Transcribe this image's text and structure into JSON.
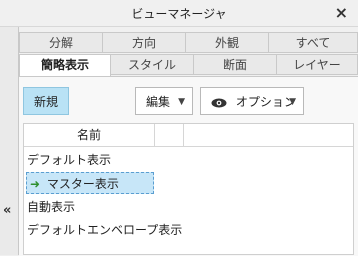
{
  "window": {
    "title": "ビューマネージャ",
    "close_symbol": "×"
  },
  "tabs": {
    "row1": [
      "分解",
      "方向",
      "外観",
      "すべて"
    ],
    "row2": [
      "簡略表示",
      "スタイル",
      "断面",
      "レイヤー"
    ],
    "active": "簡略表示"
  },
  "toolbar": {
    "new_label": "新規",
    "edit_label": "編集",
    "options_label": "オプション"
  },
  "table": {
    "column_header": "名前",
    "rows": [
      {
        "label": "デフォルト表示",
        "selected": false
      },
      {
        "label": "マスター表示",
        "selected": true,
        "marker": "➜"
      },
      {
        "label": "自動表示",
        "selected": false
      },
      {
        "label": "デフォルトエンベロープ表示",
        "selected": false
      }
    ]
  },
  "sidebar": {
    "collapse_symbol": "«"
  },
  "icons": [
    "close-icon",
    "collapse-icon",
    "eye-icon",
    "chevron-down-icon",
    "arrow-right-icon"
  ],
  "colors": {
    "new_button_bg": "#b9e2f5",
    "selection_bg": "#c7e6f8",
    "arrow": "#2f8f2f"
  }
}
